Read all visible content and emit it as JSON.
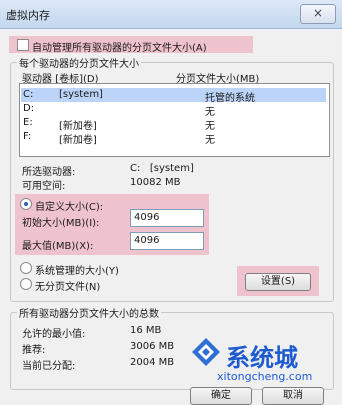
{
  "window": {
    "title": "虚拟内存",
    "close_label": "×"
  },
  "auto_manage": {
    "label": "自动管理所有驱动器的分页文件大小(A)",
    "checked": false
  },
  "per_drive": {
    "group_label": "每个驱动器的分页文件大小",
    "col_drive": "驱动器 [卷标](D)",
    "col_size": "分页文件大小(MB)",
    "rows": [
      {
        "drive": "C:",
        "label": "[system]",
        "size": "托管的系统"
      },
      {
        "drive": "D:",
        "label": "",
        "size": "无"
      },
      {
        "drive": "E:",
        "label": "[新加卷]",
        "size": "无"
      },
      {
        "drive": "F:",
        "label": "[新加卷]",
        "size": "无"
      }
    ]
  },
  "selected_drive": {
    "label": "所选驱动器:",
    "value": "C:   [system]",
    "free_label": "可用空间:",
    "free_value": "10082 MB"
  },
  "custom_size": {
    "label": "自定义大小(C):",
    "initial_label": "初始大小(MB)(I):",
    "initial_value": "4096",
    "max_label": "最大值(MB)(X):",
    "max_value": "4096"
  },
  "options": {
    "system_managed": "系统管理的大小(Y)",
    "no_paging": "无分页文件(N)",
    "set_button": "设置(S)"
  },
  "totals": {
    "group_label": "所有驱动器分页文件大小的总数",
    "min_label": "允许的最小值:",
    "min_value": "16 MB",
    "recommended_label": "推荐:",
    "recommended_value": "3006 MB",
    "allocated_label": "当前已分配:",
    "allocated_value": "2004 MB"
  },
  "buttons": {
    "ok": "确定",
    "cancel": "取消"
  },
  "watermark": {
    "brand": "系统城",
    "url": "xitongcheng.com"
  }
}
